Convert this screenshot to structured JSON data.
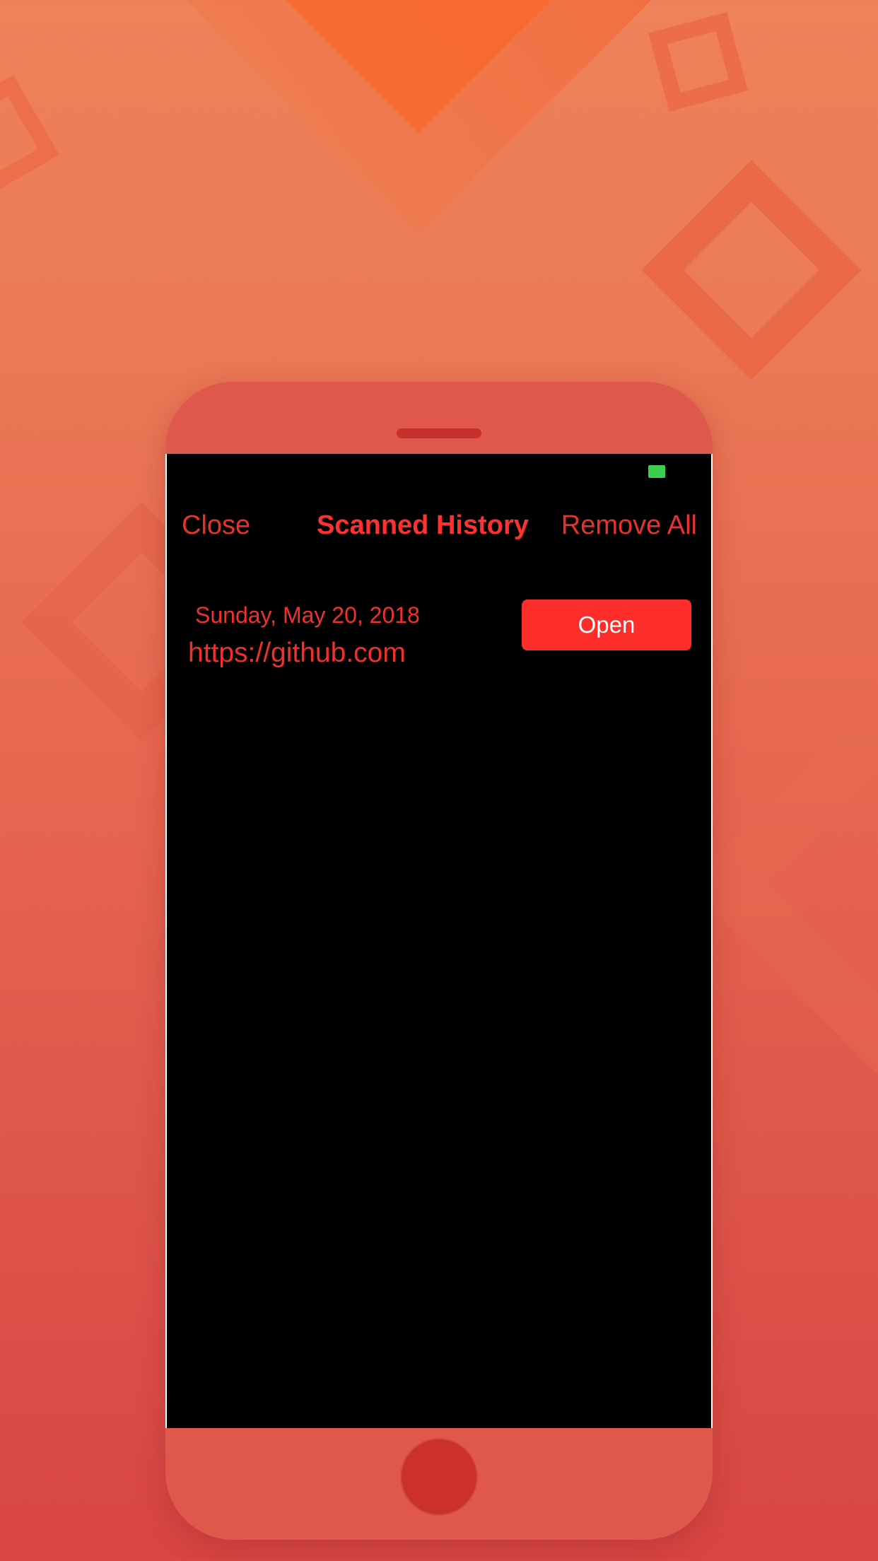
{
  "nav": {
    "close_label": "Close",
    "title": "Scanned History",
    "remove_all_label": "Remove All"
  },
  "history": {
    "items": [
      {
        "date": "Sunday, May 20, 2018",
        "url": "https://github.com",
        "open_label": "Open"
      }
    ]
  },
  "colors": {
    "accent": "#fc2d2a",
    "text_red": "#e8312e",
    "screen_background": "#000000",
    "phone_frame": "#e0584b",
    "battery": "#3ccf4e"
  },
  "icons": {
    "battery": "battery-icon",
    "home": "home-button-icon",
    "speaker": "speaker-icon"
  }
}
